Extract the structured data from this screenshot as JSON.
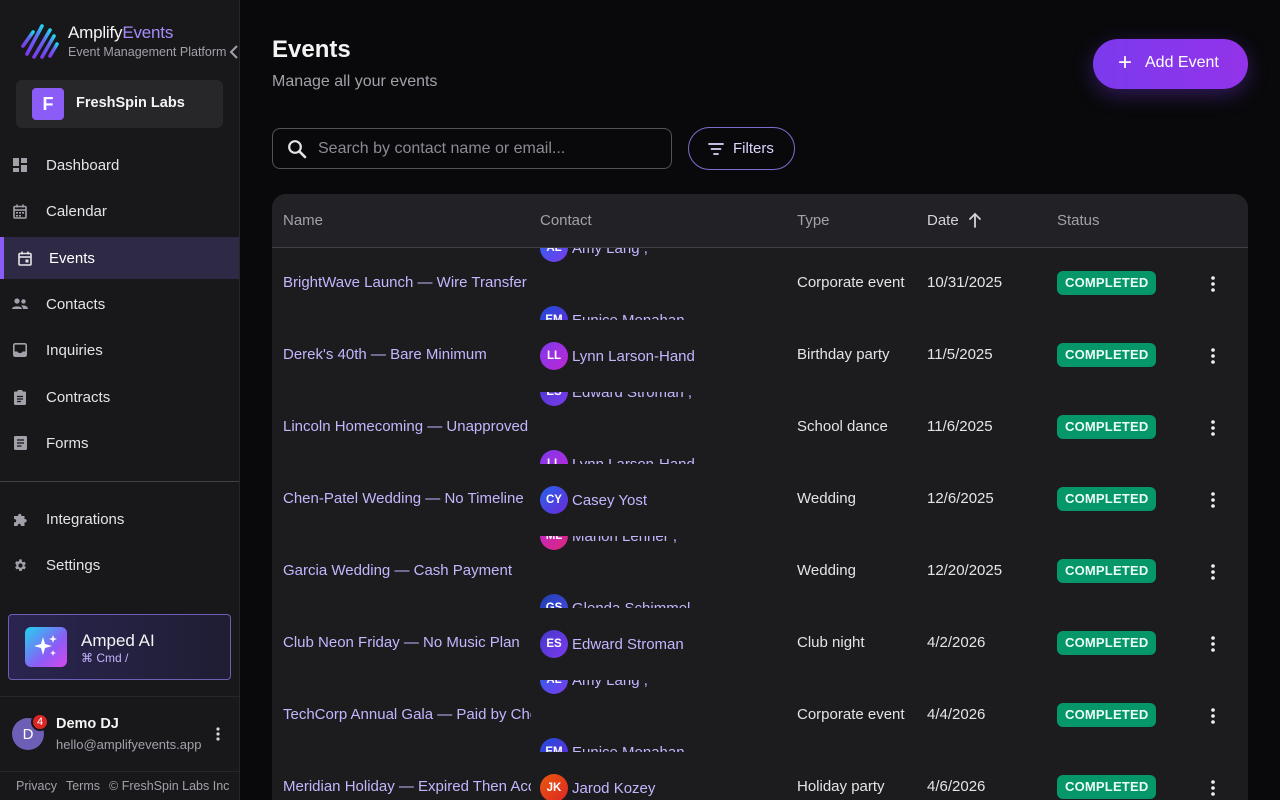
{
  "brand": {
    "name_a": "Amplify",
    "name_b": "Events",
    "subtitle": "Event Management Platform"
  },
  "org": {
    "initial": "F",
    "name": "FreshSpin Labs"
  },
  "nav": {
    "dashboard": "Dashboard",
    "calendar": "Calendar",
    "events": "Events",
    "contacts": "Contacts",
    "inquiries": "Inquiries",
    "contracts": "Contracts",
    "forms": "Forms",
    "integrations": "Integrations",
    "settings": "Settings"
  },
  "ai": {
    "title": "Amped AI",
    "shortcut": "⌘ Cmd /"
  },
  "user": {
    "initial": "D",
    "badge": "4",
    "name": "Demo DJ",
    "email": "hello@amplifyevents.app"
  },
  "footer": {
    "privacy": "Privacy",
    "terms": "Terms",
    "copyright": "© FreshSpin Labs Inc"
  },
  "page": {
    "title": "Events",
    "subtitle": "Manage all your events"
  },
  "add_button": {
    "plus": "+",
    "label": "Add Event"
  },
  "search": {
    "placeholder": "Search by contact name or email..."
  },
  "filters_label": "Filters",
  "columns": {
    "name": "Name",
    "contact": "Contact",
    "type": "Type",
    "date": "Date",
    "status": "Status"
  },
  "rows": [
    {
      "name": "BrightWave Launch — Wire Transfer",
      "type": "Corporate event",
      "date": "10/31/2025",
      "status": "COMPLETED",
      "contacts": [
        {
          "initials": "AL",
          "name": "Amy Lang ,"
        },
        {
          "initials": "EM",
          "name": "Eunice Monahan"
        }
      ]
    },
    {
      "name": "Derek's 40th — Bare Minimum",
      "type": "Birthday party",
      "date": "11/5/2025",
      "status": "COMPLETED",
      "contacts": [
        {
          "initials": "LL",
          "name": "Lynn Larson-Hand"
        }
      ]
    },
    {
      "name": "Lincoln Homecoming — Unapproved",
      "type": "School dance",
      "date": "11/6/2025",
      "status": "COMPLETED",
      "contacts": [
        {
          "initials": "ES",
          "name": "Edward Stroman ,"
        },
        {
          "initials": "LL",
          "name": "Lynn Larson-Hand"
        }
      ]
    },
    {
      "name": "Chen-Patel Wedding — No Timeline",
      "type": "Wedding",
      "date": "12/6/2025",
      "status": "COMPLETED",
      "contacts": [
        {
          "initials": "CY",
          "name": "Casey Yost"
        }
      ]
    },
    {
      "name": "Garcia Wedding — Cash Payment",
      "type": "Wedding",
      "date": "12/20/2025",
      "status": "COMPLETED",
      "contacts": [
        {
          "initials": "ML",
          "name": "Marion Lehner ,"
        },
        {
          "initials": "GS",
          "name": "Glenda Schimmel ,"
        }
      ]
    },
    {
      "name": "Club Neon Friday — No Music Plan",
      "type": "Club night",
      "date": "4/2/2026",
      "status": "COMPLETED",
      "contacts": [
        {
          "initials": "ES",
          "name": "Edward Stroman"
        }
      ]
    },
    {
      "name": "TechCorp Annual Gala — Paid by Check",
      "type": "Corporate event",
      "date": "4/4/2026",
      "status": "COMPLETED",
      "contacts": [
        {
          "initials": "AL",
          "name": "Amy Lang ,"
        },
        {
          "initials": "EM",
          "name": "Eunice Monahan"
        }
      ]
    },
    {
      "name": "Meridian Holiday — Expired Then Accepted",
      "type": "Holiday party",
      "date": "4/6/2026",
      "status": "COMPLETED",
      "contacts": [
        {
          "initials": "JK",
          "name": "Jarod Kozey"
        }
      ]
    }
  ],
  "colors": {
    "accent": "#8b5cf6",
    "status_completed": "#059669",
    "link": "#c4b5fd"
  }
}
